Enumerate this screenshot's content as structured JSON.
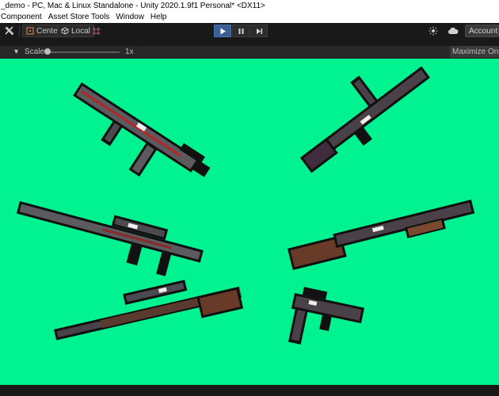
{
  "window": {
    "title": "_demo - PC, Mac & Linux Standalone - Unity 2020.1.9f1 Personal* <DX11>"
  },
  "menu": {
    "items": [
      "Component",
      "Asset Store Tools",
      "Window",
      "Help"
    ]
  },
  "toolbar": {
    "tool_icon": "crossed-tools-icon",
    "pivot_label": "Center",
    "space_label": "Local",
    "grid_icon": "grid-snap-icon",
    "play_icon": "play-icon",
    "pause_icon": "pause-icon",
    "step_icon": "step-icon",
    "services_icon": "sun-services-icon",
    "cloud_icon": "cloud-icon",
    "account_label": "Account",
    "accent_color": "#3a5f96"
  },
  "game_view": {
    "scale_label": "Scale",
    "scale_value": "1x",
    "maximize_label": "Maximize On Play",
    "background_color": "#00f390"
  },
  "scene": {
    "sprites": [
      {
        "name": "smg-red-stripe"
      },
      {
        "name": "ak-rifle"
      },
      {
        "name": "scoped-assault-rifle"
      },
      {
        "name": "shotgun-wood-stock"
      },
      {
        "name": "sniper-rifle"
      },
      {
        "name": "machine-pistol"
      }
    ]
  }
}
